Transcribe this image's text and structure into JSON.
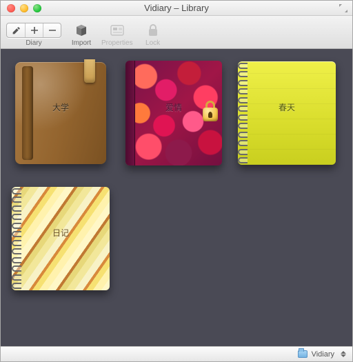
{
  "window": {
    "title": "Vidiary – Library"
  },
  "toolbar": {
    "diary_label": "Diary",
    "import_label": "Import",
    "properties_label": "Properties",
    "lock_label": "Lock",
    "seg": {
      "edit_icon": "pencil-icon",
      "add_icon": "plus-icon",
      "remove_icon": "minus-icon"
    }
  },
  "diaries": [
    {
      "name": "大学",
      "style": "leather"
    },
    {
      "name": "爱情",
      "style": "hearts"
    },
    {
      "name": "春天",
      "style": "yellow"
    },
    {
      "name": "日记",
      "style": "stripe"
    }
  ],
  "status": {
    "path_label": "Vidiary"
  }
}
